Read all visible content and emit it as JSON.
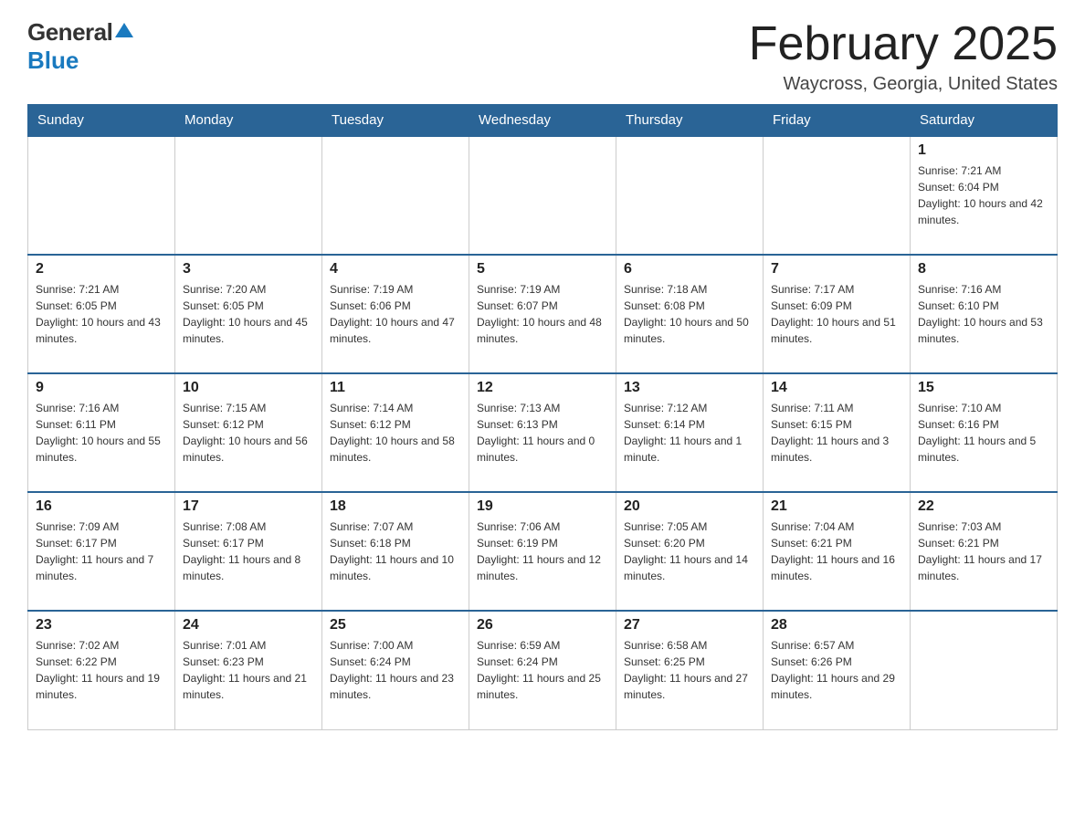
{
  "header": {
    "logo_general": "General",
    "logo_blue": "Blue",
    "month_title": "February 2025",
    "location": "Waycross, Georgia, United States"
  },
  "days_of_week": [
    "Sunday",
    "Monday",
    "Tuesday",
    "Wednesday",
    "Thursday",
    "Friday",
    "Saturday"
  ],
  "weeks": [
    [
      {
        "day": "",
        "info": ""
      },
      {
        "day": "",
        "info": ""
      },
      {
        "day": "",
        "info": ""
      },
      {
        "day": "",
        "info": ""
      },
      {
        "day": "",
        "info": ""
      },
      {
        "day": "",
        "info": ""
      },
      {
        "day": "1",
        "info": "Sunrise: 7:21 AM\nSunset: 6:04 PM\nDaylight: 10 hours and 42 minutes."
      }
    ],
    [
      {
        "day": "2",
        "info": "Sunrise: 7:21 AM\nSunset: 6:05 PM\nDaylight: 10 hours and 43 minutes."
      },
      {
        "day": "3",
        "info": "Sunrise: 7:20 AM\nSunset: 6:05 PM\nDaylight: 10 hours and 45 minutes."
      },
      {
        "day": "4",
        "info": "Sunrise: 7:19 AM\nSunset: 6:06 PM\nDaylight: 10 hours and 47 minutes."
      },
      {
        "day": "5",
        "info": "Sunrise: 7:19 AM\nSunset: 6:07 PM\nDaylight: 10 hours and 48 minutes."
      },
      {
        "day": "6",
        "info": "Sunrise: 7:18 AM\nSunset: 6:08 PM\nDaylight: 10 hours and 50 minutes."
      },
      {
        "day": "7",
        "info": "Sunrise: 7:17 AM\nSunset: 6:09 PM\nDaylight: 10 hours and 51 minutes."
      },
      {
        "day": "8",
        "info": "Sunrise: 7:16 AM\nSunset: 6:10 PM\nDaylight: 10 hours and 53 minutes."
      }
    ],
    [
      {
        "day": "9",
        "info": "Sunrise: 7:16 AM\nSunset: 6:11 PM\nDaylight: 10 hours and 55 minutes."
      },
      {
        "day": "10",
        "info": "Sunrise: 7:15 AM\nSunset: 6:12 PM\nDaylight: 10 hours and 56 minutes."
      },
      {
        "day": "11",
        "info": "Sunrise: 7:14 AM\nSunset: 6:12 PM\nDaylight: 10 hours and 58 minutes."
      },
      {
        "day": "12",
        "info": "Sunrise: 7:13 AM\nSunset: 6:13 PM\nDaylight: 11 hours and 0 minutes."
      },
      {
        "day": "13",
        "info": "Sunrise: 7:12 AM\nSunset: 6:14 PM\nDaylight: 11 hours and 1 minute."
      },
      {
        "day": "14",
        "info": "Sunrise: 7:11 AM\nSunset: 6:15 PM\nDaylight: 11 hours and 3 minutes."
      },
      {
        "day": "15",
        "info": "Sunrise: 7:10 AM\nSunset: 6:16 PM\nDaylight: 11 hours and 5 minutes."
      }
    ],
    [
      {
        "day": "16",
        "info": "Sunrise: 7:09 AM\nSunset: 6:17 PM\nDaylight: 11 hours and 7 minutes."
      },
      {
        "day": "17",
        "info": "Sunrise: 7:08 AM\nSunset: 6:17 PM\nDaylight: 11 hours and 8 minutes."
      },
      {
        "day": "18",
        "info": "Sunrise: 7:07 AM\nSunset: 6:18 PM\nDaylight: 11 hours and 10 minutes."
      },
      {
        "day": "19",
        "info": "Sunrise: 7:06 AM\nSunset: 6:19 PM\nDaylight: 11 hours and 12 minutes."
      },
      {
        "day": "20",
        "info": "Sunrise: 7:05 AM\nSunset: 6:20 PM\nDaylight: 11 hours and 14 minutes."
      },
      {
        "day": "21",
        "info": "Sunrise: 7:04 AM\nSunset: 6:21 PM\nDaylight: 11 hours and 16 minutes."
      },
      {
        "day": "22",
        "info": "Sunrise: 7:03 AM\nSunset: 6:21 PM\nDaylight: 11 hours and 17 minutes."
      }
    ],
    [
      {
        "day": "23",
        "info": "Sunrise: 7:02 AM\nSunset: 6:22 PM\nDaylight: 11 hours and 19 minutes."
      },
      {
        "day": "24",
        "info": "Sunrise: 7:01 AM\nSunset: 6:23 PM\nDaylight: 11 hours and 21 minutes."
      },
      {
        "day": "25",
        "info": "Sunrise: 7:00 AM\nSunset: 6:24 PM\nDaylight: 11 hours and 23 minutes."
      },
      {
        "day": "26",
        "info": "Sunrise: 6:59 AM\nSunset: 6:24 PM\nDaylight: 11 hours and 25 minutes."
      },
      {
        "day": "27",
        "info": "Sunrise: 6:58 AM\nSunset: 6:25 PM\nDaylight: 11 hours and 27 minutes."
      },
      {
        "day": "28",
        "info": "Sunrise: 6:57 AM\nSunset: 6:26 PM\nDaylight: 11 hours and 29 minutes."
      },
      {
        "day": "",
        "info": ""
      }
    ]
  ]
}
